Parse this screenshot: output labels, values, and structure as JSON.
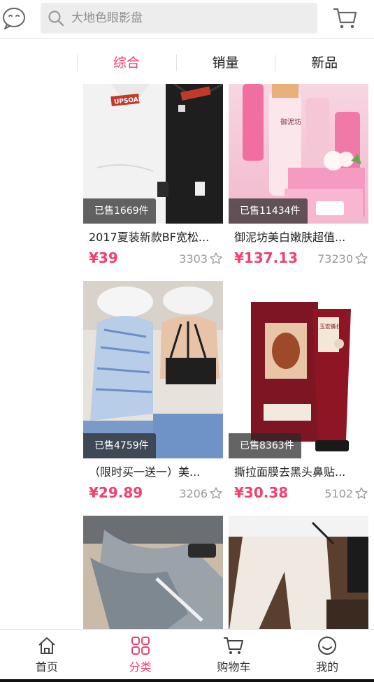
{
  "header": {
    "search_placeholder": "大地色眼影盘",
    "chat_icon": "chat-bubble-icon",
    "cart_icon": "shopping-cart-icon"
  },
  "sort_tabs": [
    {
      "label": "综合",
      "active": true
    },
    {
      "label": "销量",
      "active": false
    },
    {
      "label": "新品",
      "active": false
    }
  ],
  "products": [
    {
      "sold": "已售1669件",
      "title": "2017夏装新款BF宽松...",
      "price": "¥39",
      "favorites": "3303"
    },
    {
      "sold": "已售11434件",
      "title": "御泥坊美白嫩肤超值...",
      "price": "¥137.13",
      "favorites": "73230"
    },
    {
      "sold": "已售4759件",
      "title": "（限时买一送一）美...",
      "price": "¥29.89",
      "favorites": "3206"
    },
    {
      "sold": "已售8363件",
      "title": "撕拉面膜去黑头鼻贴...",
      "price": "¥30.38",
      "favorites": "5102"
    },
    {
      "sold": "",
      "title": "",
      "price": "",
      "favorites": ""
    },
    {
      "sold": "",
      "title": "",
      "price": "",
      "favorites": ""
    }
  ],
  "product_images": {
    "tshirt_logo": "UPSOAR",
    "cosmetics_brand": "御泥坊",
    "mask_brand": "玉宏撕拉"
  },
  "bottom_nav": [
    {
      "label": "首页",
      "icon": "home-icon",
      "active": false
    },
    {
      "label": "分类",
      "icon": "category-grid-icon",
      "active": true
    },
    {
      "label": "购物车",
      "icon": "shopping-cart-icon",
      "active": false
    },
    {
      "label": "我的",
      "icon": "user-face-icon",
      "active": false
    }
  ],
  "colors": {
    "accent": "#f43f6e",
    "muted": "#999999",
    "badge_bg": "#3a3a3a"
  }
}
